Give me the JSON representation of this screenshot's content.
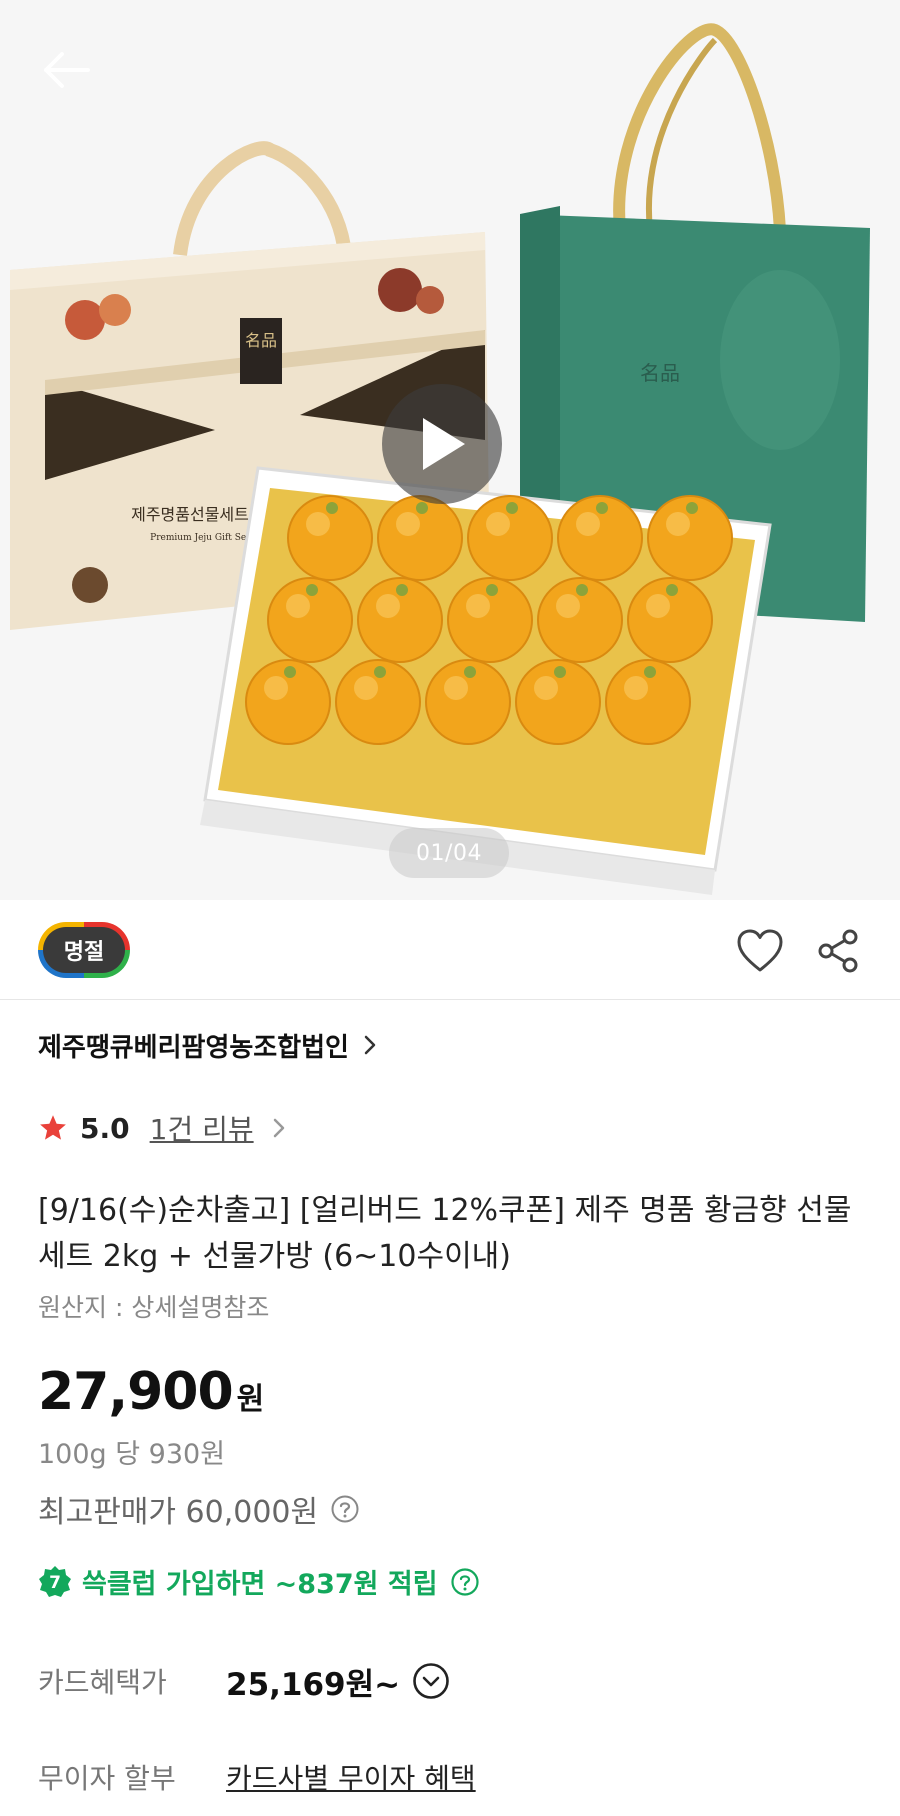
{
  "hero": {
    "box_logo": "名品",
    "box_title_ko": "제주명품선물세트",
    "box_title_en": "Premium Jeju Gift Set",
    "counter": "01/04"
  },
  "badge": {
    "label": "명절"
  },
  "seller": {
    "name": "제주땡큐베리팜영농조합법인"
  },
  "rating": {
    "score": "5.0",
    "reviews": "1건 리뷰"
  },
  "product": {
    "title": "[9/16(수)순차출고] [얼리버드 12%쿠폰] 제주 명품 황금향 선물세트 2kg + 선물가방 (6~10수이내)",
    "origin": "원산지 : 상세설명참조"
  },
  "price": {
    "amount": "27,900",
    "currency": "원",
    "unit_price": "100g 당 930원",
    "max_price": "최고판매가 60,000원"
  },
  "club": {
    "badge": "7",
    "text": "쓱클럽 가입하면 ~837원 적립"
  },
  "card": {
    "label": "카드혜택가",
    "value": "25,169원~"
  },
  "installment": {
    "label": "무이자 할부",
    "link": "카드사별 무이자 혜택"
  },
  "colors": {
    "accent_green": "#13a85c",
    "star_red": "#e9413a",
    "bag_green": "#3b8a72",
    "ribbon_gold": "#d8b864"
  }
}
